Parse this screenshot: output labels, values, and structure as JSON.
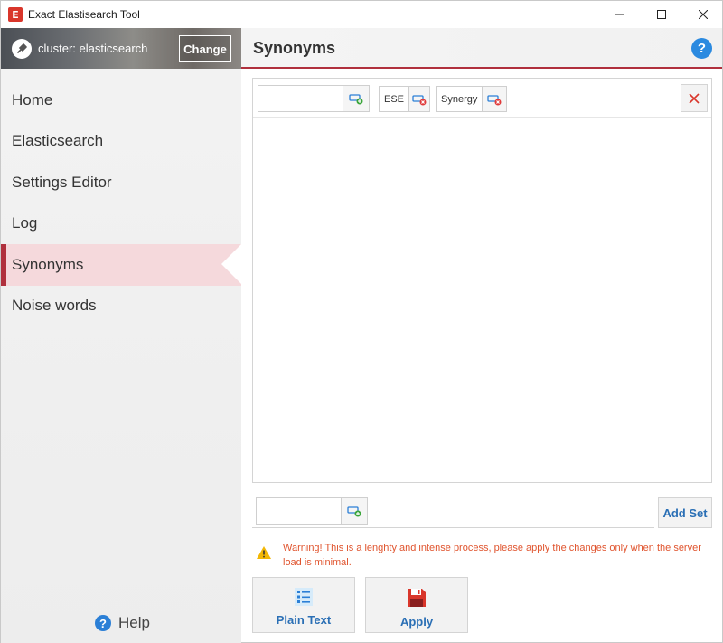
{
  "window": {
    "title": "Exact Elastisearch Tool",
    "app_icon_letter": "E",
    "controls": [
      "minimize",
      "maximize",
      "close"
    ]
  },
  "sidebar": {
    "cluster_label": "cluster: elasticsearch",
    "change_label": "Change",
    "items": [
      {
        "label": "Home",
        "active": false
      },
      {
        "label": "Elasticsearch",
        "active": false
      },
      {
        "label": "Settings Editor",
        "active": false
      },
      {
        "label": "Log",
        "active": false
      },
      {
        "label": "Synonyms",
        "active": true
      },
      {
        "label": "Noise words",
        "active": false
      }
    ],
    "help_label": "Help"
  },
  "header": {
    "title": "Synonyms",
    "help_icon": "?"
  },
  "synonym_set": {
    "new_term_value": "",
    "terms": [
      "ESE",
      "Synergy"
    ]
  },
  "new_set": {
    "value": "",
    "add_label": "Add Set"
  },
  "warning": {
    "text": "Warning! This is a lenghty and intense process, please apply the changes only when the server load is minimal."
  },
  "actions": {
    "plain_text_label": "Plain Text",
    "apply_label": "Apply"
  },
  "colors": {
    "accent": "#b0303d",
    "link_blue": "#2a6fb5",
    "warning_orange": "#e0542e",
    "help_blue": "#2b8ae0"
  }
}
